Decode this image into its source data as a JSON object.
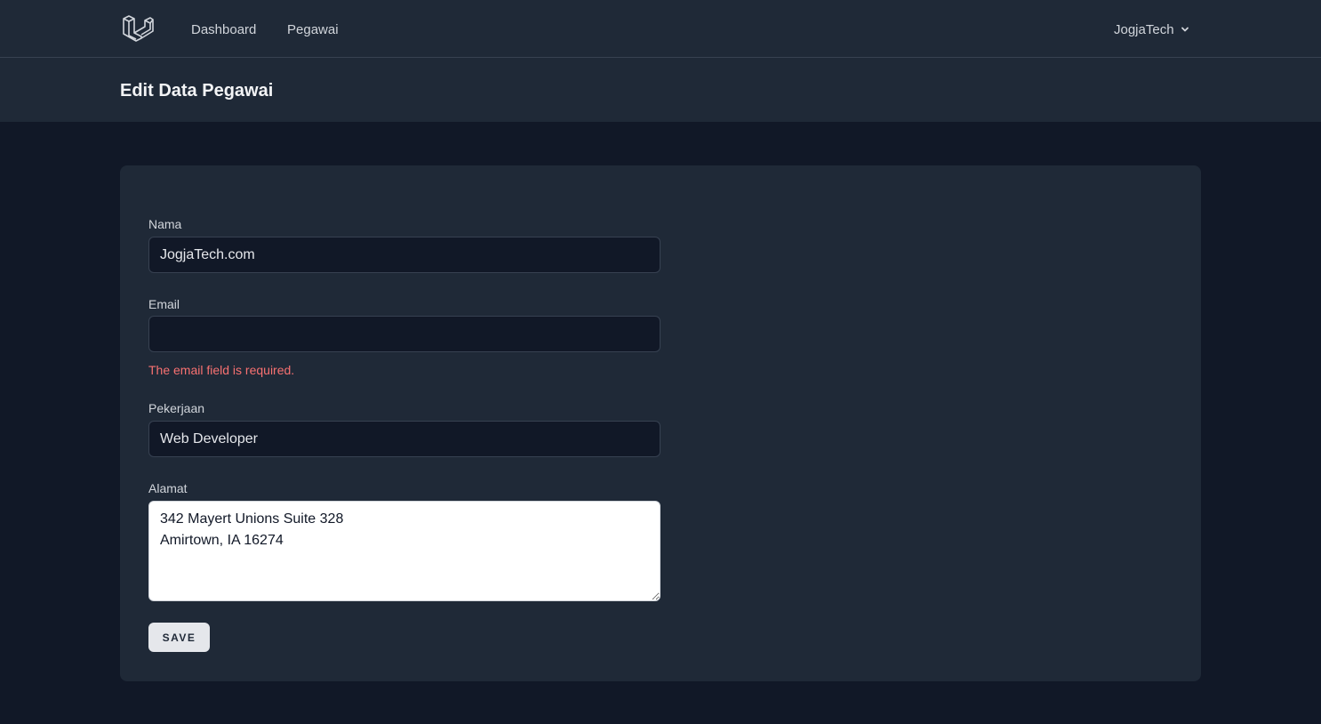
{
  "nav": {
    "logo_icon": "laravel-logo-icon",
    "links": [
      "Dashboard",
      "Pegawai"
    ],
    "user": "JogjaTech",
    "user_menu_icon": "chevron-down-icon"
  },
  "header": {
    "title": "Edit Data Pegawai"
  },
  "form": {
    "nama": {
      "label": "Nama",
      "value": "JogjaTech.com"
    },
    "email": {
      "label": "Email",
      "value": "",
      "error": "The email field is required."
    },
    "pekerjaan": {
      "label": "Pekerjaan",
      "value": "Web Developer"
    },
    "alamat": {
      "label": "Alamat",
      "value": "342 Mayert Unions Suite 328\nAmirtown, IA 16274"
    },
    "save_label": "SAVE"
  },
  "colors": {
    "background": "#111827",
    "panel": "#1f2937",
    "error": "#f87171",
    "button": "#e5e7eb"
  }
}
